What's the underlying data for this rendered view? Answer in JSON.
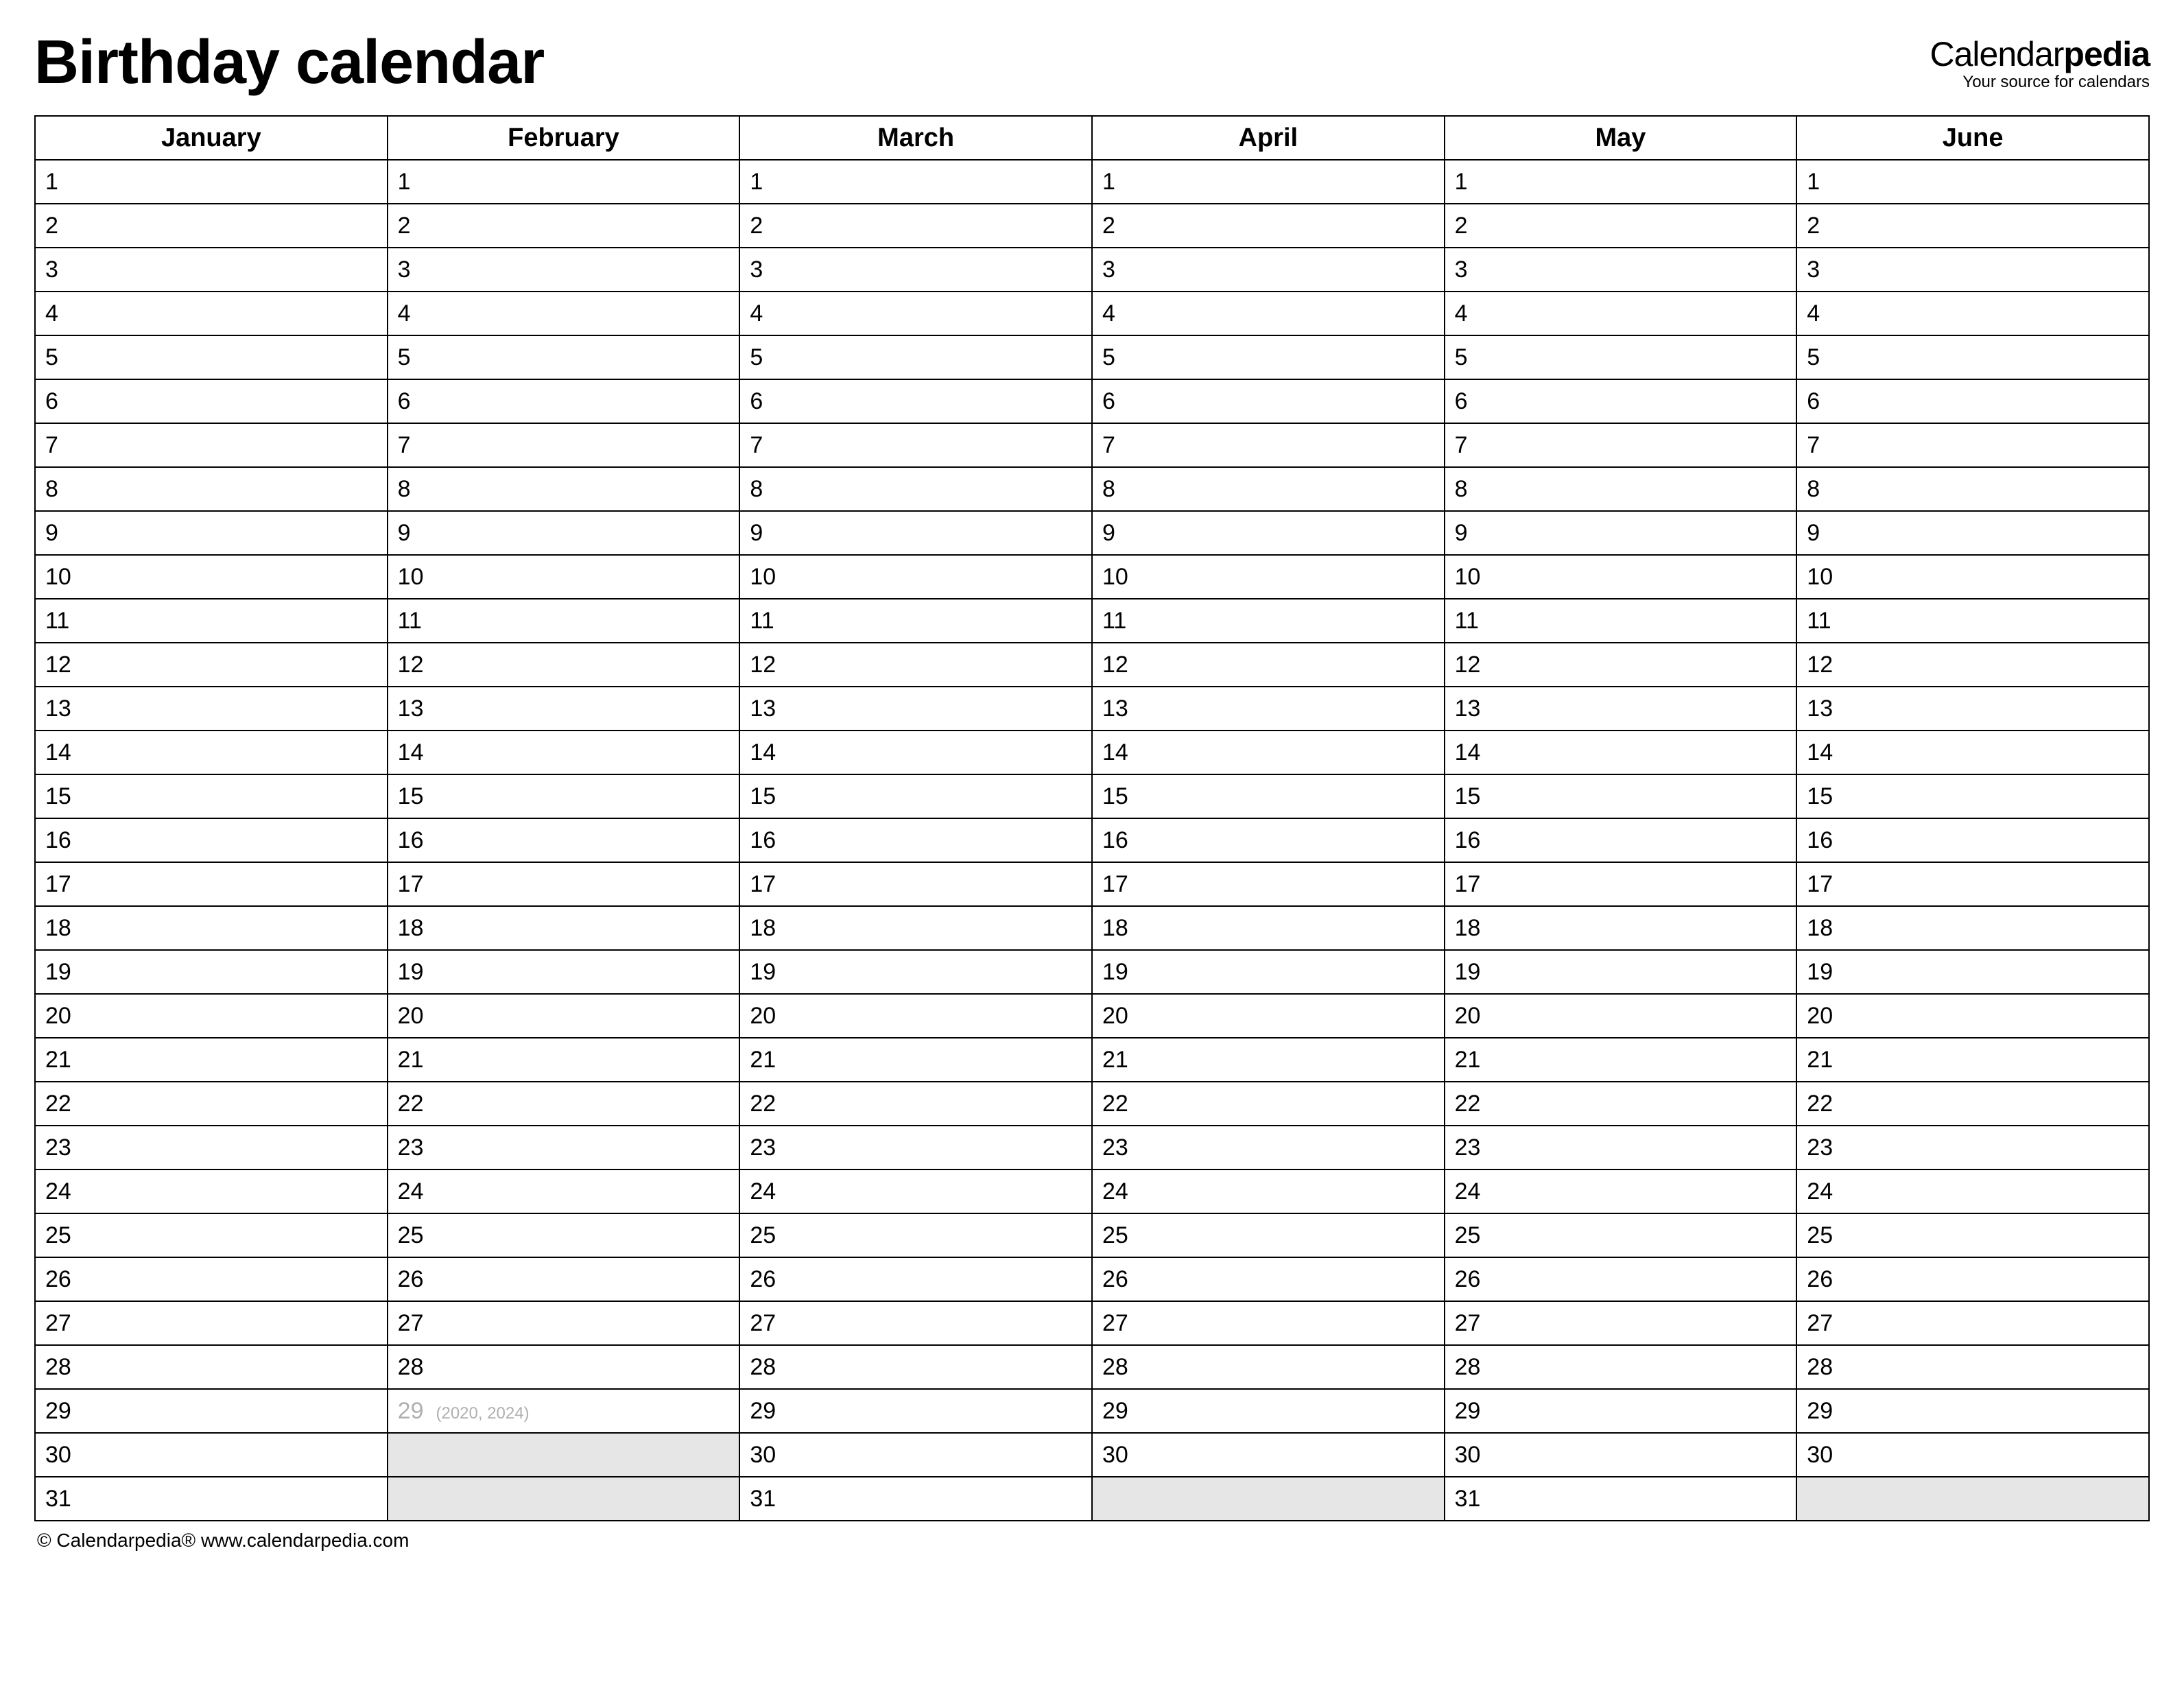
{
  "title": "Birthday calendar",
  "brand": {
    "name_prefix": "Calendar",
    "name_bold": "pedia",
    "tagline": "Your source for calendars"
  },
  "months": [
    {
      "name": "January",
      "days": 31
    },
    {
      "name": "February",
      "days": 29,
      "leap_note": "(2020, 2024)"
    },
    {
      "name": "March",
      "days": 31
    },
    {
      "name": "April",
      "days": 30
    },
    {
      "name": "May",
      "days": 31
    },
    {
      "name": "June",
      "days": 30
    }
  ],
  "max_rows": 31,
  "footer": "© Calendarpedia®   www.calendarpedia.com"
}
